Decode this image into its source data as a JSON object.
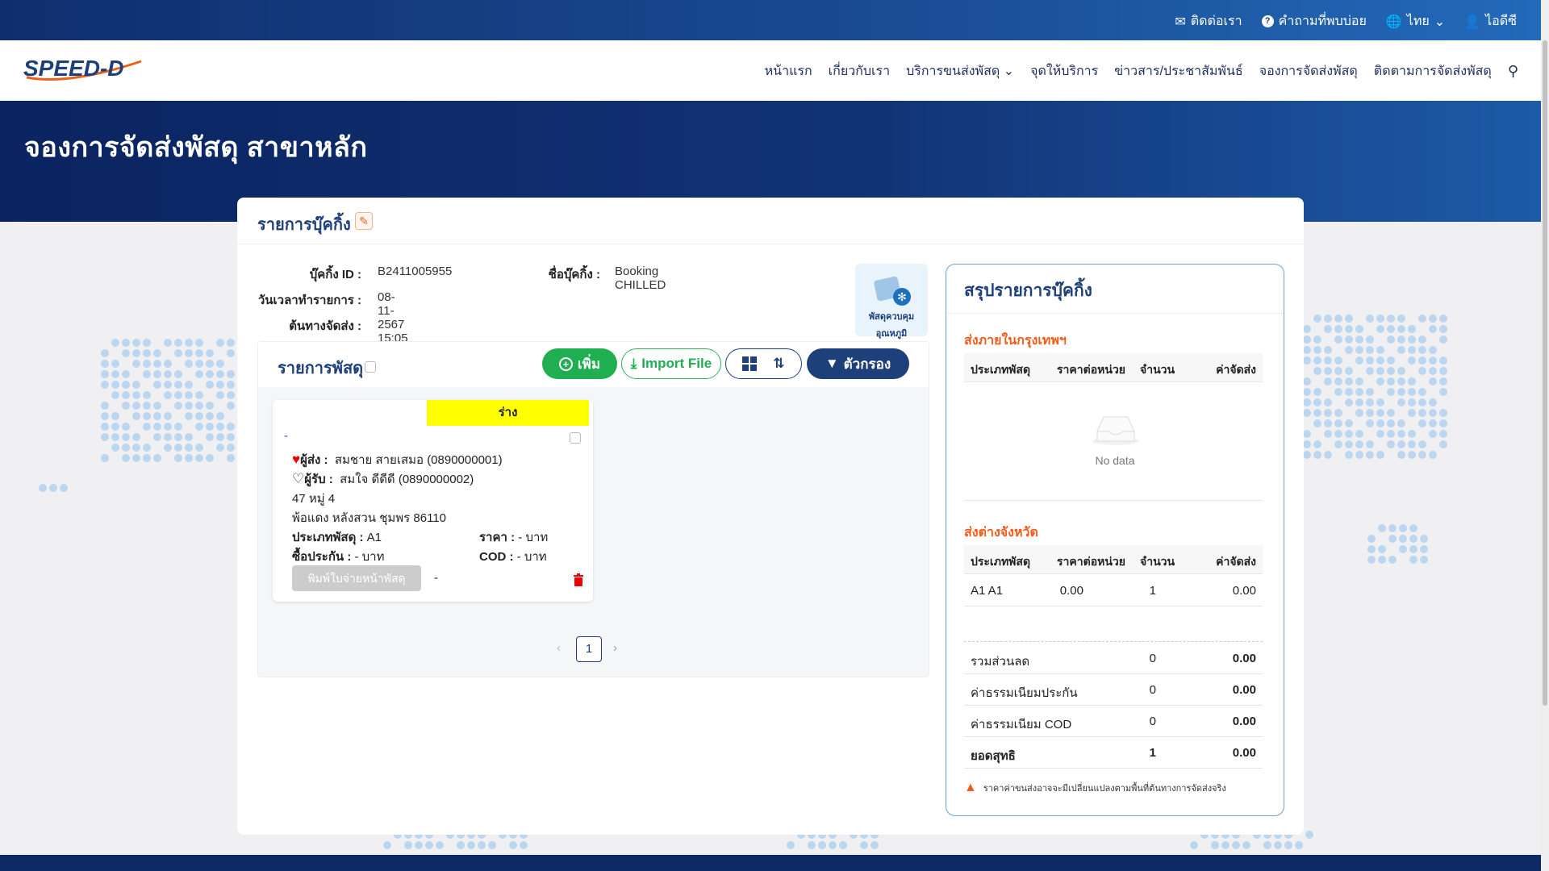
{
  "topbar": {
    "contact": "ติดต่อเรา",
    "faq": "คำถามที่พบบ่อย",
    "language": "ไทย",
    "user": "ไอดีซี"
  },
  "brand": {
    "logo_text": "SPEED-D",
    "logo_badge": "SPEED-D"
  },
  "nav": {
    "items": [
      "หน้าแรก",
      "เกี่ยวกับเรา",
      "บริการขนส่งพัสดุ",
      "จุดให้บริการ",
      "ข่าวสาร/ประชาสัมพันธ์",
      "จองการจัดส่งพัสดุ",
      "ติดตามการจัดส่งพัสดุ"
    ]
  },
  "hero": {
    "title": "จองการจัดส่งพัสดุ สาขาหลัก"
  },
  "booking": {
    "section_title": "รายการบุ๊คกิ้ง",
    "id_label": "บุ๊คกิ้ง ID :",
    "id_value": "B2411005955",
    "name_label": "ชื่อบุ๊คกิ้ง :",
    "name_value": "Booking CHILLED",
    "datetime_label": "วันเวลาทำรายการ :",
    "datetime_value": "08-11-2567 15:05",
    "origin_label": "ต้นทางจัดส่ง :",
    "origin_value": "",
    "chilled_label_1": "พัสดุควบคุม",
    "chilled_label_2": "อุณหภูมิ"
  },
  "parcels": {
    "title": "รายการพัสดุ",
    "add_button": "เพิ่ม",
    "import_button": "Import File",
    "filter_button": "ตัวกรอง",
    "items": [
      {
        "status": "ร่าง",
        "tracking": "-",
        "sender_label": "ผู้ส่ง :",
        "sender": "สมชาย สายเสมอ  (0890000001)",
        "receiver_label": "ผู้รับ :",
        "receiver": "สมใจ ดีดีดี  (0890000002)",
        "address_1": "47 หมู่ 4",
        "address_2": "พ้อแดง หลังสวน ชุมพร 86110",
        "type_label": "ประเภทพัสดุ :",
        "type_value": "A1",
        "price_label": "ราคา :",
        "price_value": "- บาท",
        "insurance_label": "ซื้อประกัน :",
        "insurance_value": "- บาท",
        "cod_label": "COD :",
        "cod_value": "- บาท",
        "print_button": "พิมพ์ใบจ่ายหน้าพัสดุ",
        "print_note": "-"
      }
    ],
    "pagination": {
      "current": "1"
    }
  },
  "summary": {
    "title": "สรุปรายการบุ๊คกิ้ง",
    "bangkok_title": "ส่งภายในกรุงเทพฯ",
    "province_title": "ส่งต่างจังหวัด",
    "headers": [
      "ประเภทพัสดุ",
      "ราคาต่อหน่วย",
      "จำนวน",
      "ค่าจัดส่ง"
    ],
    "no_data": "No data",
    "province_rows": [
      {
        "type": "A1 A1",
        "unit_price": "0.00",
        "qty": "1",
        "fee": "0.00"
      }
    ],
    "totals": [
      {
        "label": "รวมส่วนลด",
        "qty": "0",
        "amount": "0.00"
      },
      {
        "label": "ค่าธรรมเนียมประกัน",
        "qty": "0",
        "amount": "0.00"
      },
      {
        "label": "ค่าธรรมเนียม COD",
        "qty": "0",
        "amount": "0.00"
      },
      {
        "label": "ยอดสุทธิ",
        "qty": "1",
        "amount": "0.00"
      }
    ],
    "note": "ราคาค่าขนส่งอาจจะมีเปลี่ยนแปลงตามพื้นที่ต้นทางการจัดส่งจริง"
  },
  "colors": {
    "brand_navy": "#1d3f7a",
    "success": "#1fae50",
    "accent_orange": "#f25c19",
    "draft_yellow": "#ffff00"
  }
}
